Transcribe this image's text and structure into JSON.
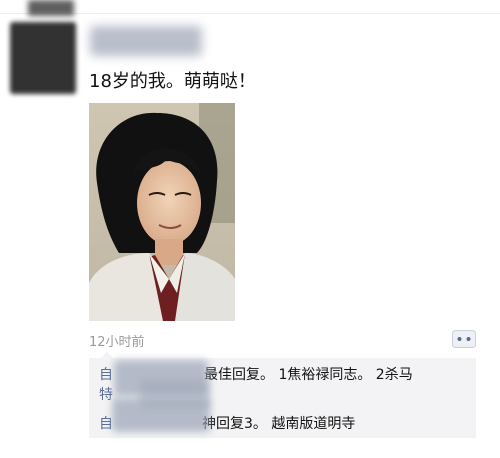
{
  "post": {
    "caption": "18岁的我。萌萌哒！",
    "timestamp": "12小时前",
    "comment_icon": "comment-bubble-icon"
  },
  "comments": [
    {
      "nick": "自",
      "text": "最佳回复。 1焦裕禄同志。 2杀马"
    },
    {
      "nick": "特",
      "text": ""
    },
    {
      "nick": "自",
      "text": "神回复3。 越南版道明寺"
    }
  ],
  "colors": {
    "nickname": "#576b95",
    "timestamp": "#9b9b9b",
    "comment_bg": "#f3f3f5"
  }
}
